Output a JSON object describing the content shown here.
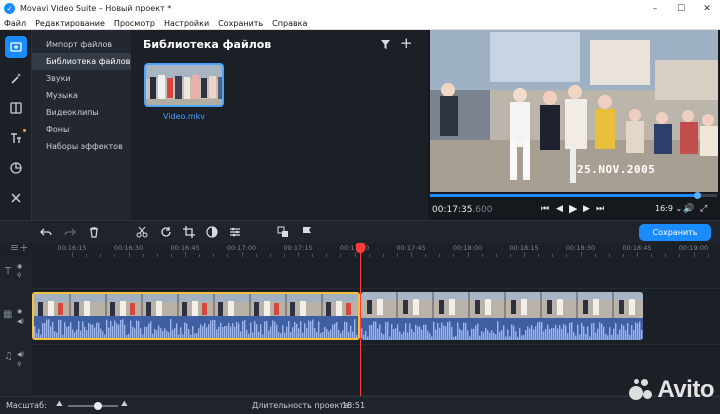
{
  "window": {
    "title": "Movavi Video Suite – Новый проект *",
    "icon_name": "movavi-logo-icon",
    "controls": [
      "minimize",
      "maximize",
      "close"
    ]
  },
  "menu": [
    "Файл",
    "Редактирование",
    "Просмотр",
    "Настройки",
    "Сохранить",
    "Справка"
  ],
  "left_tools": [
    "import-icon",
    "magic-wand-icon",
    "transitions-icon",
    "titles-icon",
    "stickers-icon",
    "tools-icon"
  ],
  "categories": [
    {
      "label": "Импорт файлов",
      "active": false
    },
    {
      "label": "Библиотека файлов",
      "active": true
    },
    {
      "label": "Звуки",
      "active": false
    },
    {
      "label": "Музыка",
      "active": false
    },
    {
      "label": "Видеоклипы",
      "active": false
    },
    {
      "label": "Фоны",
      "active": false
    },
    {
      "label": "Наборы эффектов",
      "active": false
    }
  ],
  "library": {
    "title": "Библиотека файлов",
    "files": [
      {
        "name": "Video.mkv"
      }
    ]
  },
  "player": {
    "overlay_date": "25.NOV.2005",
    "timecode_main": "00:17:35",
    "timecode_ms": ".600",
    "aspect": "16:9",
    "progress": 0.93
  },
  "timeline": {
    "save_label": "Сохранить",
    "ruler_labels": [
      "00:16:15",
      "00:16:30",
      "00:16:45",
      "00:17:00",
      "00:17:15",
      "00:17:30",
      "00:17:45",
      "00:18:00",
      "00:18:15",
      "00:18:30",
      "00:18:45",
      "00:19:00"
    ],
    "playhead_time": "00:17:35"
  },
  "status": {
    "zoom_label": "Масштаб:",
    "zoom_level": 0.6,
    "duration_label": "Длительность проекта:",
    "duration_value": "18:51"
  },
  "watermark": {
    "text": "Avito"
  },
  "colors": {
    "accent": "#1a8cff",
    "selection": "#f3c23a",
    "playhead": "#ff3b3b",
    "panel": "#1b1f26"
  }
}
